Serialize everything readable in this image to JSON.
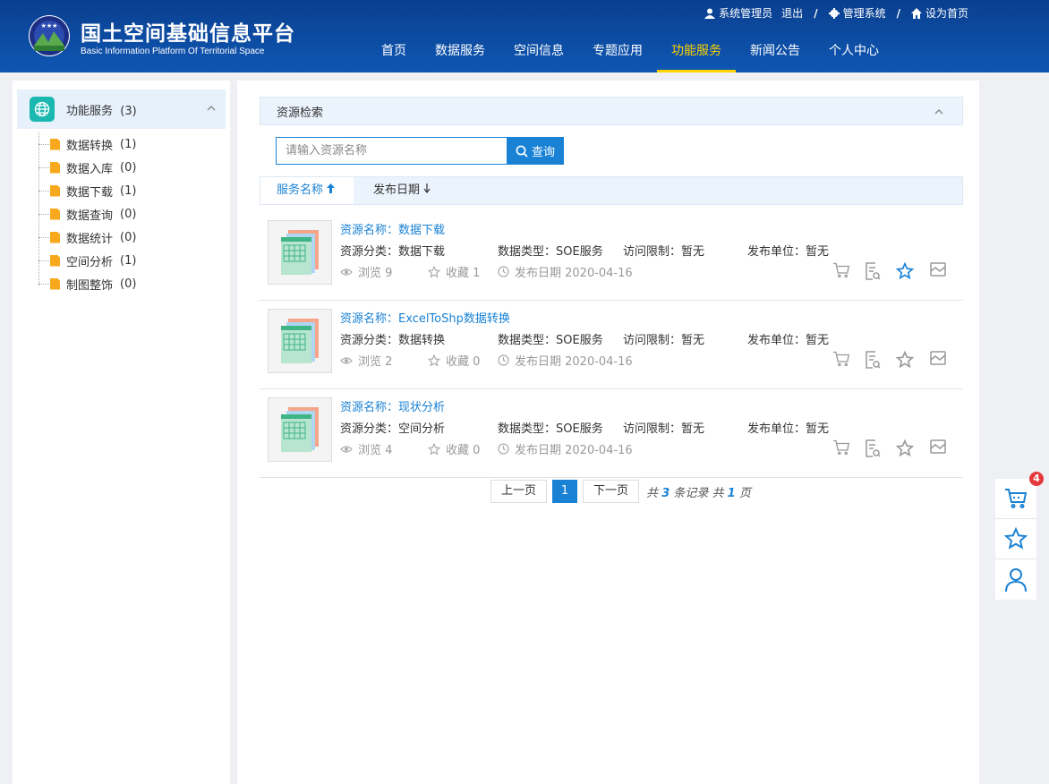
{
  "header": {
    "title": "国土空间基础信息平台",
    "subtitle": "Basic Information  Platform Of Territorial Space",
    "user": "系统管理员",
    "logout": "退出",
    "admin": "管理系统",
    "homepage": "设为首页",
    "sep": "/",
    "nav": [
      "首页",
      "数据服务",
      "空间信息",
      "专题应用",
      "功能服务",
      "新闻公告",
      "个人中心"
    ],
    "active_nav": "功能服务"
  },
  "sidebar": {
    "title": "功能服务",
    "count": "(3)",
    "items": [
      {
        "label": "数据转换",
        "count": "(1)"
      },
      {
        "label": "数据入库",
        "count": "(0)"
      },
      {
        "label": "数据下载",
        "count": "(1)"
      },
      {
        "label": "数据查询",
        "count": "(0)"
      },
      {
        "label": "数据统计",
        "count": "(0)"
      },
      {
        "label": "空间分析",
        "count": "(1)"
      },
      {
        "label": "制图整饰",
        "count": "(0)"
      }
    ]
  },
  "search": {
    "section_title": "资源检索",
    "placeholder": "请输入资源名称",
    "button": "查询"
  },
  "sort": {
    "name": "服务名称",
    "date": "发布日期"
  },
  "resources": [
    {
      "name": "资源名称：数据下载",
      "category": "资源分类：数据下载",
      "data_type": "数据类型：SOE服务",
      "access": "访问限制：暂无",
      "publisher": "发布单位：暂无",
      "views": "浏览 9",
      "favs": "收藏 1",
      "date": "发布日期   2020-04-16"
    },
    {
      "name": "资源名称：ExcelToShp数据转换",
      "category": "资源分类：数据转换",
      "data_type": "数据类型：SOE服务",
      "access": "访问限制：暂无",
      "publisher": "发布单位：暂无",
      "views": "浏览 2",
      "favs": "收藏 0",
      "date": "发布日期   2020-04-16"
    },
    {
      "name": "资源名称：现状分析",
      "category": "资源分类：空间分析",
      "data_type": "数据类型：SOE服务",
      "access": "访问限制：暂无",
      "publisher": "发布单位：暂无",
      "views": "浏览 4",
      "favs": "收藏 0",
      "date": "发布日期   2020-04-16"
    }
  ],
  "pager": {
    "prev": "上一页",
    "page": "1",
    "next": "下一页",
    "info_prefix": "共",
    "total": "3",
    "info_mid": "条记录 共",
    "pages": "1",
    "info_suffix": "页"
  },
  "float": {
    "cart_count": "4"
  },
  "colors": {
    "header_bg": "#0f57b3",
    "nav_active": "#ffd200",
    "accent": "#1a82d5",
    "badge": "#e4393c",
    "folder": "#f8a81c",
    "sidebar_icon": "#1bb8b2"
  }
}
